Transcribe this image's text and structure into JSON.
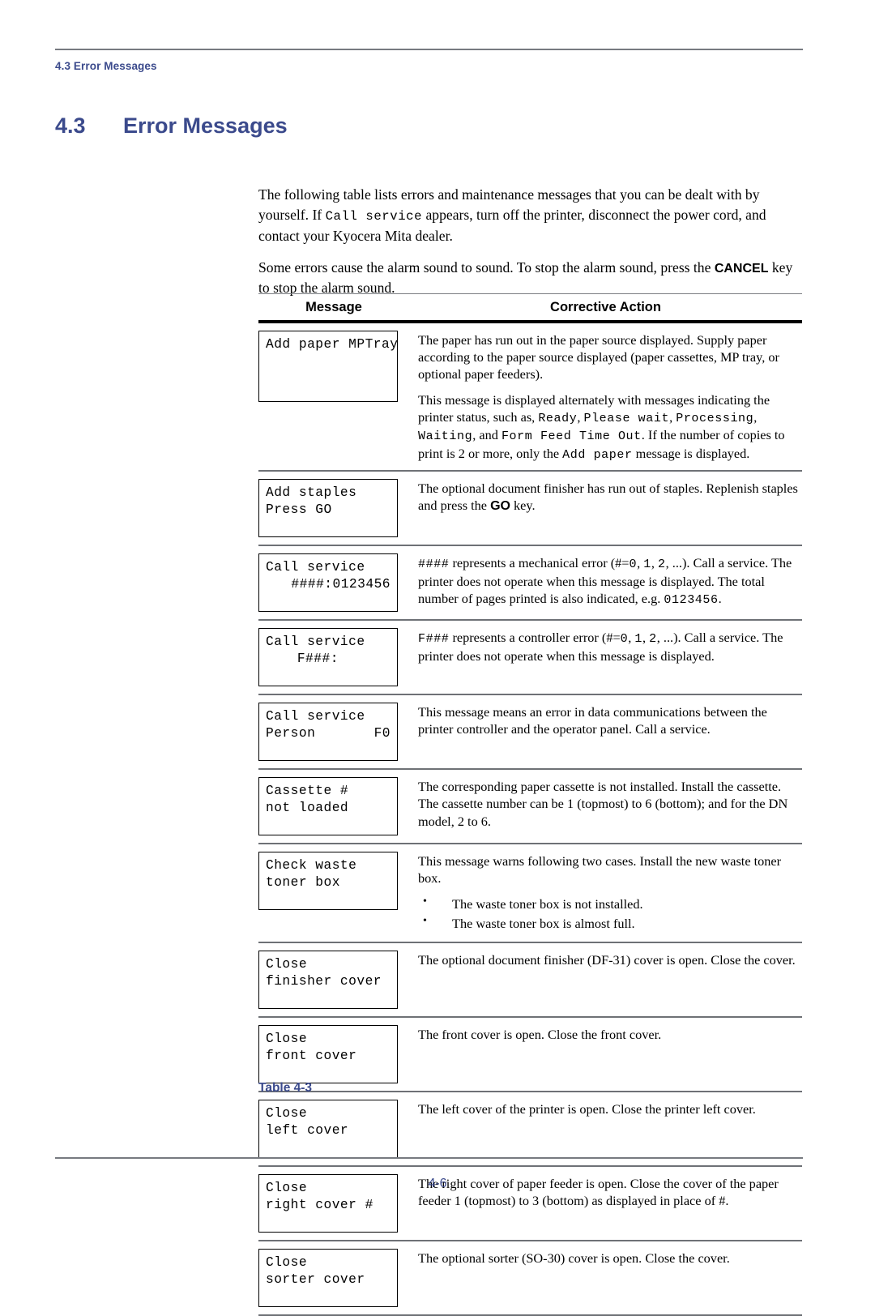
{
  "colors": {
    "accent": "#3b4a8c",
    "rule": "#777a80",
    "text": "#000000"
  },
  "header": {
    "running_head": "4.3 Error Messages"
  },
  "section": {
    "number": "4.3",
    "title": "Error Messages"
  },
  "intro": {
    "para1_part1": "The following table lists errors and maintenance messages that you can be dealt with by yourself. If ",
    "para1_code": "Call service",
    "para1_part2": " appears, turn off the printer, disconnect the power cord, and contact your Kyocera Mita dealer.",
    "para2_part1": "Some errors cause the alarm sound to sound. To stop the alarm sound, press the ",
    "para2_key": "CANCEL",
    "para2_part2": " key to stop the alarm sound."
  },
  "table": {
    "headers": {
      "message": "Message",
      "action": "Corrective Action"
    },
    "caption": "Table 4-3",
    "rows": [
      {
        "lcd_lines": [
          "Add paper MPTray"
        ],
        "lcd_size": "xtall",
        "action_paras": [
          "The paper has run out in the paper source displayed. Supply paper according to the paper source displayed (paper cassettes, MP tray, or optional paper feeders)."
        ],
        "action_rich": {
          "p2_a": "This message is displayed alternately with messages indicating the printer status, such as, ",
          "p2_c1": "Ready",
          "p2_b": ", ",
          "p2_c2": "Please wait",
          "p2_c3": "Processing",
          "p2_c4": "Waiting",
          "p2_d": ", and ",
          "p2_c5": "Form Feed Time Out",
          "p2_e": ".  If the number of copies to print is 2 or more, only the ",
          "p2_c6": "Add paper",
          "p2_f": " message is displayed."
        }
      },
      {
        "lcd_lines": [
          "Add staples",
          "Press GO"
        ],
        "lcd_size": "tall",
        "action_rich": {
          "a": "The optional document finisher has run out of staples. Replenish staples and press the ",
          "key": "GO",
          "b": " key."
        }
      },
      {
        "lcd_lines": [
          "Call service",
          "####:0123456"
        ],
        "lcd_align": [
          "left",
          "right"
        ],
        "lcd_size": "tall",
        "action_rich": {
          "c1": "####",
          "a": " represents a mechanical error (#=",
          "c2": "0",
          "b": ", ",
          "c3": "1",
          "c4": "2",
          "d": ", ...). Call a service. The printer does not operate when this message is displayed. The total number of pages printed is also indicated, e.g. ",
          "c5": "0123456",
          "e": "."
        }
      },
      {
        "lcd_lines": [
          "Call service",
          "F###:"
        ],
        "lcd_align": [
          "left",
          "indent"
        ],
        "lcd_size": "tall",
        "action_rich": {
          "c1": "F###",
          "a": " represents a controller error (#=",
          "c2": "0",
          "b": ", ",
          "c3": "1",
          "c4": "2",
          "d": ", ...). Call a service. The printer does not operate when this message is displayed."
        }
      },
      {
        "lcd_lines": [
          "Call service",
          "Person",
          "F0"
        ],
        "lcd_size": "tall",
        "action_paras": [
          "This message means an error in data communications between the printer controller and the operator panel. Call a service."
        ]
      },
      {
        "lcd_lines": [
          "Cassette #",
          "not loaded"
        ],
        "lcd_size": "tall",
        "action_paras": [
          "The corresponding paper cassette is not installed. Install the cassette.  The cassette number can be 1 (topmost) to 6 (bottom); and for the DN model, 2 to 6."
        ]
      },
      {
        "lcd_lines": [
          "Check waste",
          "toner box"
        ],
        "lcd_size": "tall",
        "action_paras": [
          "This message warns following two cases. Install the new waste toner box."
        ],
        "bullets": [
          "The waste toner box is not installed.",
          "The waste toner box is almost full."
        ]
      },
      {
        "lcd_lines": [
          "Close",
          "finisher cover"
        ],
        "lcd_size": "tall",
        "action_paras": [
          "The optional document finisher (DF-31) cover is open. Close the cover."
        ]
      },
      {
        "lcd_lines": [
          "Close",
          "front cover"
        ],
        "lcd_size": "tall",
        "action_paras": [
          "The front cover is open. Close the front cover."
        ]
      },
      {
        "lcd_lines": [
          "Close",
          "left cover"
        ],
        "lcd_size": "tall",
        "action_paras": [
          "The left cover of the printer is open. Close the printer left cover."
        ]
      },
      {
        "lcd_lines": [
          "Close",
          "right cover #"
        ],
        "lcd_size": "tall",
        "action_paras": [
          "The right cover of paper feeder is open. Close the cover of the paper feeder 1 (topmost) to 3 (bottom) as displayed in place of #."
        ]
      },
      {
        "lcd_lines": [
          "Close",
          "sorter cover"
        ],
        "lcd_size": "tall",
        "action_paras": [
          "The optional sorter (SO-30) cover is open. Close the cover."
        ]
      }
    ]
  },
  "footer": {
    "page_number": "4-6"
  }
}
